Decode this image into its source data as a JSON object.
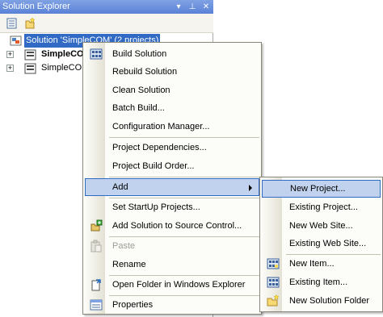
{
  "panel": {
    "title": "Solution Explorer",
    "buttons": {
      "dropdown": "▾",
      "pin": "⊥",
      "close": "✕"
    }
  },
  "tree": {
    "solution_label": "Solution 'SimpleCOM' (2 projects)",
    "project1_label": "SimpleCO",
    "project2_label": "SimpleCOM"
  },
  "context_menu": {
    "items": [
      {
        "label": "Build Solution",
        "icon": "build-icon"
      },
      {
        "label": "Rebuild Solution"
      },
      {
        "label": "Clean Solution"
      },
      {
        "label": "Batch Build..."
      },
      {
        "label": "Configuration Manager..."
      },
      {
        "label": "Project Dependencies..."
      },
      {
        "label": "Project Build Order..."
      },
      {
        "label": "Add",
        "submenu": true
      },
      {
        "label": "Set StartUp Projects..."
      },
      {
        "label": "Add Solution to Source Control...",
        "icon": "source-control-icon"
      },
      {
        "label": "Paste",
        "icon": "paste-icon",
        "disabled": true
      },
      {
        "label": "Rename"
      },
      {
        "label": "Open Folder in Windows Explorer",
        "icon": "open-folder-icon"
      },
      {
        "label": "Properties",
        "icon": "properties-icon"
      }
    ]
  },
  "submenu": {
    "items": [
      {
        "label": "New Project..."
      },
      {
        "label": "Existing Project..."
      },
      {
        "label": "New Web Site..."
      },
      {
        "label": "Existing Web Site..."
      },
      {
        "label": "New Item...",
        "icon": "new-item-icon"
      },
      {
        "label": "Existing Item...",
        "icon": "existing-item-icon"
      },
      {
        "label": "New Solution Folder",
        "icon": "new-folder-icon"
      }
    ]
  },
  "colors": {
    "title_bar": "#5b81d6",
    "selection": "#316ac5",
    "menu_highlight": "#c1d2ee"
  }
}
